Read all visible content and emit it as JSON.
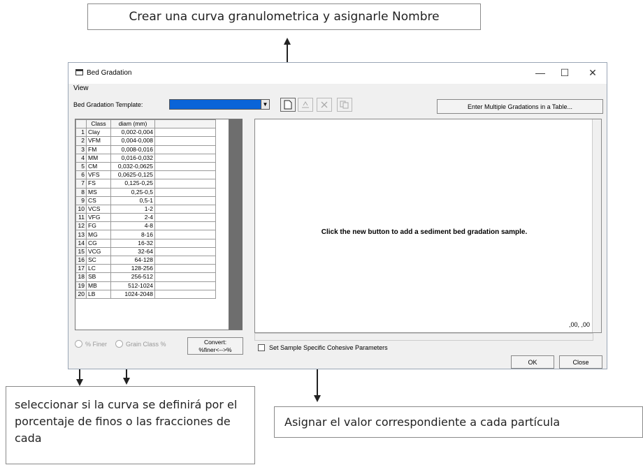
{
  "callouts": {
    "top": "Crear una curva granulometrica y asignarle Nombre",
    "bottom_left": "seleccionar si la curva se definirá por el porcentaje de finos o las fracciones de cada",
    "bottom_right": "Asignar el valor correspondiente a cada partícula"
  },
  "window": {
    "title": "Bed Gradation",
    "menu": "View",
    "minimize": "—",
    "maximize": "☐",
    "close": "✕"
  },
  "toolbar": {
    "template_label": "Bed Gradation Template:",
    "template_value": "",
    "multi_button": "Enter Multiple Gradations in a Table..."
  },
  "grid": {
    "headers": [
      "",
      "Class",
      "diam (mm)",
      ""
    ],
    "rows": [
      {
        "n": "1",
        "cls": "Clay",
        "diam": "0,002-0,004"
      },
      {
        "n": "2",
        "cls": "VFM",
        "diam": "0,004-0,008"
      },
      {
        "n": "3",
        "cls": "FM",
        "diam": "0,008-0,016"
      },
      {
        "n": "4",
        "cls": "MM",
        "diam": "0,016-0,032"
      },
      {
        "n": "5",
        "cls": "CM",
        "diam": "0,032-0,0625"
      },
      {
        "n": "6",
        "cls": "VFS",
        "diam": "0,0625-0,125"
      },
      {
        "n": "7",
        "cls": "FS",
        "diam": "0,125-0,25"
      },
      {
        "n": "8",
        "cls": "MS",
        "diam": "0,25-0,5"
      },
      {
        "n": "9",
        "cls": "CS",
        "diam": "0,5-1"
      },
      {
        "n": "10",
        "cls": "VCS",
        "diam": "1-2"
      },
      {
        "n": "11",
        "cls": "VFG",
        "diam": "2-4"
      },
      {
        "n": "12",
        "cls": "FG",
        "diam": "4-8"
      },
      {
        "n": "13",
        "cls": "MG",
        "diam": "8-16"
      },
      {
        "n": "14",
        "cls": "CG",
        "diam": "16-32"
      },
      {
        "n": "15",
        "cls": "VCG",
        "diam": "32-64"
      },
      {
        "n": "16",
        "cls": "SC",
        "diam": "64-128"
      },
      {
        "n": "17",
        "cls": "LC",
        "diam": "128-256"
      },
      {
        "n": "18",
        "cls": "SB",
        "diam": "256-512"
      },
      {
        "n": "19",
        "cls": "MB",
        "diam": "512-1024"
      },
      {
        "n": "20",
        "cls": "LB",
        "diam": "1024-2048"
      }
    ]
  },
  "options": {
    "pct_finer": "% Finer",
    "grain_class": "Grain Class %",
    "convert_line1": "Convert:",
    "convert_line2": "%finer<-->%"
  },
  "plot": {
    "message": "Click the new button to add a sediment bed gradation sample.",
    "axis_readout": ",00, ,00"
  },
  "footer": {
    "cohesive_label": "Set Sample Specific Cohesive Parameters",
    "ok": "OK",
    "close": "Close"
  }
}
